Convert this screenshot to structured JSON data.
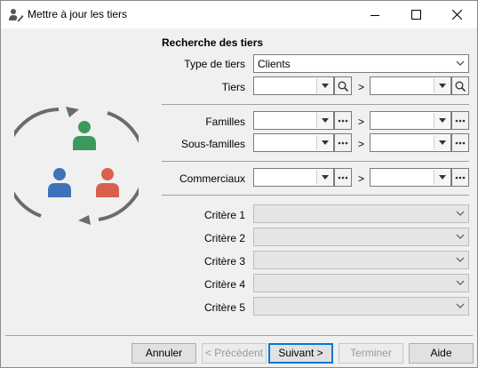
{
  "window": {
    "title": "Mettre à jour les tiers"
  },
  "form": {
    "section_title": "Recherche des tiers",
    "type_tiers_label": "Type de tiers",
    "type_tiers_value": "Clients",
    "tiers_label": "Tiers",
    "familles_label": "Familles",
    "sous_familles_label": "Sous-familles",
    "commerciaux_label": "Commerciaux",
    "range_separator": ">",
    "criteres": [
      "Critère 1",
      "Critère 2",
      "Critère 3",
      "Critère 4",
      "Critère 5"
    ]
  },
  "buttons": {
    "annuler": "Annuler",
    "precedent": "< Précédent",
    "suivant": "Suivant >",
    "terminer": "Terminer",
    "aide": "Aide"
  },
  "colors": {
    "person_green": "#3b9a5b",
    "person_blue": "#3f72b8",
    "person_red": "#d9604f",
    "cycle_arrow": "#6b6b6b",
    "default_button_border": "#0078d7"
  }
}
